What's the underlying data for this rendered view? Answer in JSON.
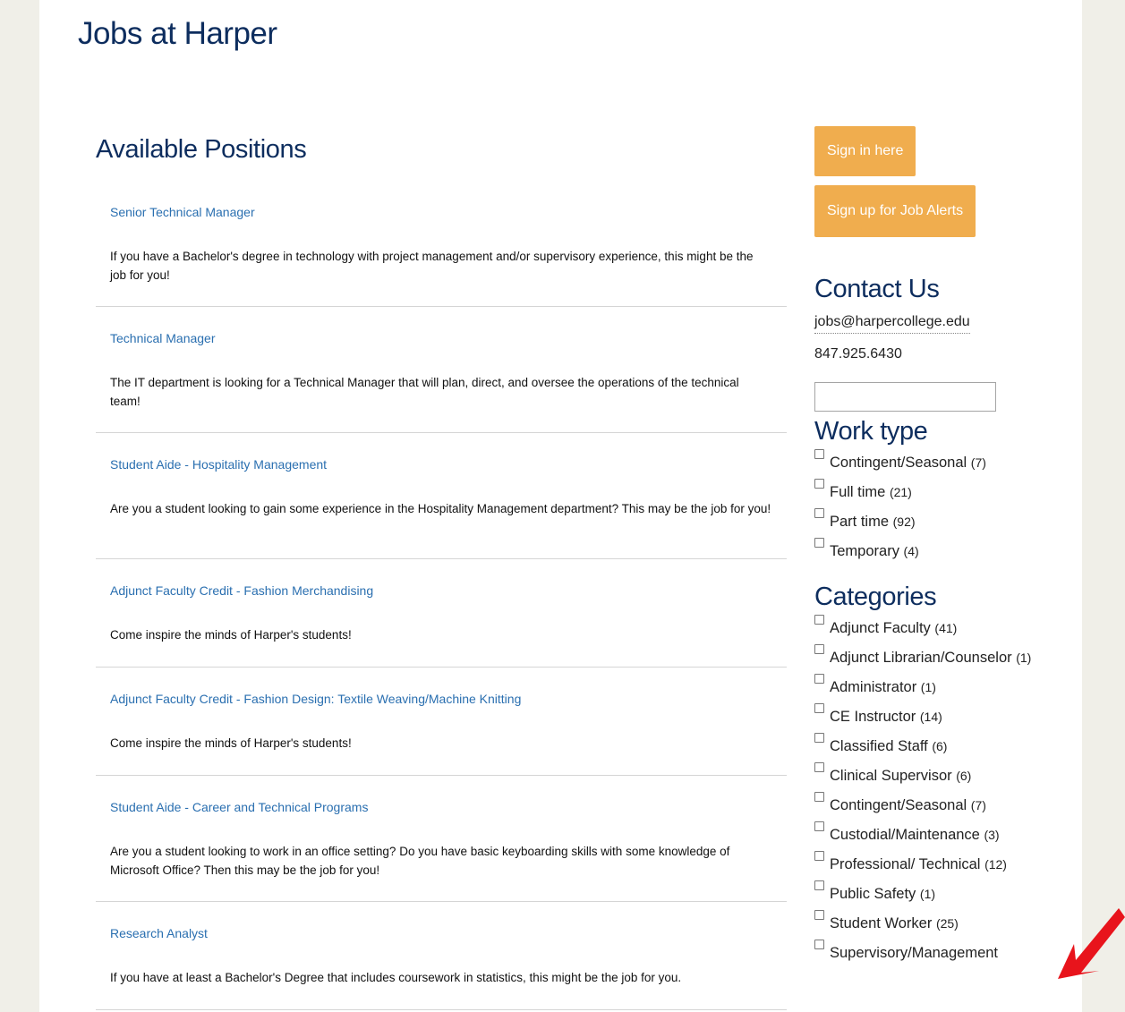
{
  "site": {
    "title": "Jobs at Harper"
  },
  "positions": {
    "heading": "Available Positions",
    "jobs": [
      {
        "title": "Senior Technical Manager",
        "description": "If you have a Bachelor's degree in technology with project management and/or supervisory experience, this might be the job for you!"
      },
      {
        "title": "Technical Manager",
        "description": "The IT department is looking for a Technical Manager that will plan, direct, and oversee the operations of the technical team!"
      },
      {
        "title": "Student Aide - Hospitality Management",
        "description": "Are you a student looking to gain some experience in the Hospitality Management department? This may be the job for you!"
      },
      {
        "title": "Adjunct Faculty Credit - Fashion Merchandising",
        "description": "Come inspire the minds of Harper's students!"
      },
      {
        "title": "Adjunct Faculty Credit - Fashion Design: Textile Weaving/Machine Knitting",
        "description": "Come inspire the minds of Harper's students!"
      },
      {
        "title": "Student Aide - Career and Technical Programs",
        "description": "Are you a student looking to work in an office setting? Do you have basic keyboarding skills with some knowledge of Microsoft Office? Then this may be the job for you!"
      },
      {
        "title": "Research Analyst",
        "description": "If you have at least a Bachelor's Degree that includes coursework in statistics, this might be the job for you."
      }
    ]
  },
  "sidebar": {
    "sign_in_label": "Sign in here",
    "job_alerts_label": "Sign up for Job Alerts",
    "contact": {
      "heading": "Contact Us",
      "email": "jobs@harpercollege.edu",
      "phone": "847.925.6430"
    },
    "search": {
      "value": "",
      "placeholder": ""
    },
    "work_type": {
      "heading": "Work type",
      "options": [
        {
          "label": "Contingent/Seasonal",
          "count": "(7)"
        },
        {
          "label": "Full time",
          "count": "(21)"
        },
        {
          "label": "Part time",
          "count": "(92)"
        },
        {
          "label": "Temporary",
          "count": "(4)"
        }
      ]
    },
    "categories": {
      "heading": "Categories",
      "options": [
        {
          "label": "Adjunct Faculty",
          "count": "(41)"
        },
        {
          "label": "Adjunct Librarian/Counselor",
          "count": "(1)"
        },
        {
          "label": "Administrator",
          "count": "(1)"
        },
        {
          "label": "CE Instructor",
          "count": "(14)"
        },
        {
          "label": "Classified Staff",
          "count": "(6)"
        },
        {
          "label": "Clinical Supervisor",
          "count": "(6)"
        },
        {
          "label": "Contingent/Seasonal",
          "count": "(7)"
        },
        {
          "label": "Custodial/Maintenance",
          "count": "(3)"
        },
        {
          "label": "Professional/ Technical",
          "count": "(12)"
        },
        {
          "label": "Public Safety",
          "count": "(1)"
        },
        {
          "label": "Student Worker",
          "count": "(25)"
        },
        {
          "label": "Supervisory/Management",
          "count": ""
        }
      ]
    }
  },
  "annotation": {
    "arrow_color": "#e8141c",
    "icon": "red-arrow-icon"
  }
}
